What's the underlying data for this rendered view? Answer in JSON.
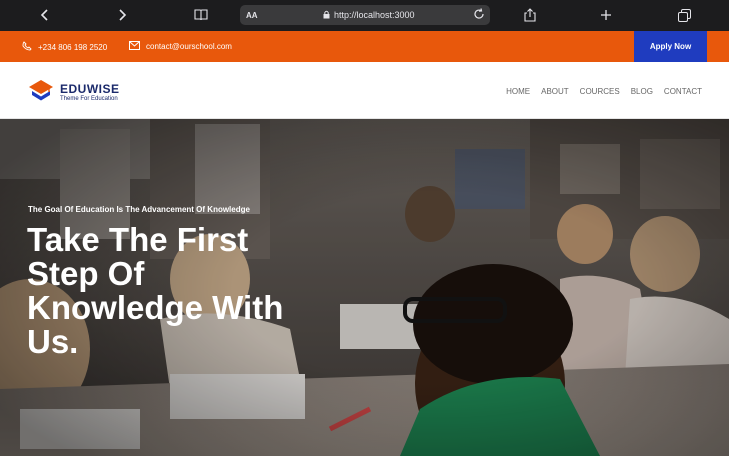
{
  "browser": {
    "text_size_label": "AA",
    "url": "http://localhost:3000"
  },
  "topbar": {
    "phone": "+234 806 198 2520",
    "email": "contact@ourschool.com",
    "apply_label": "Apply Now",
    "bg_color": "#e8580c",
    "apply_color": "#1f3cbf"
  },
  "brand": {
    "name": "EDUWISE",
    "tagline": "Theme For Education"
  },
  "nav": {
    "items": [
      {
        "label": "HOME"
      },
      {
        "label": "ABOUT"
      },
      {
        "label": "COURCES"
      },
      {
        "label": "BLOG"
      },
      {
        "label": "CONTACT"
      }
    ]
  },
  "hero": {
    "subtitle": "The Goal Of Education Is The Advancement Of Knowledge",
    "title": "Take The First Step Of Knowledge With Us."
  }
}
